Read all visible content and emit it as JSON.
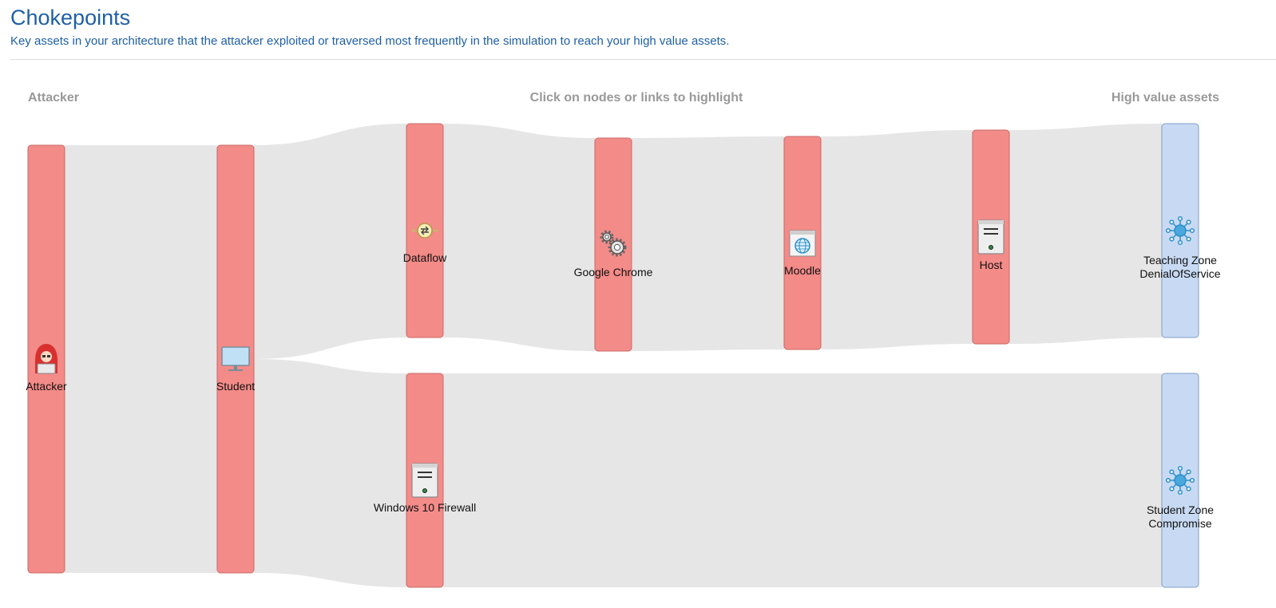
{
  "header": {
    "title": "Chokepoints",
    "subtitle": "Key assets in your architecture that the attacker exploited or traversed most frequently in the simulation to reach your high value assets."
  },
  "sankey": {
    "column_labels": {
      "left": "Attacker",
      "center": "Click on nodes or links to highlight",
      "right": "High value assets"
    },
    "colors": {
      "node_fill": "#f38b88",
      "node_stroke": "#c96a67",
      "target_fill": "#c8daf3",
      "target_stroke": "#7f9cc9",
      "link": "#e6e6e6"
    },
    "nodes": [
      {
        "id": "attacker",
        "label": [
          "Attacker"
        ],
        "icon": "hacker-icon",
        "kind": "source"
      },
      {
        "id": "student",
        "label": [
          "Student"
        ],
        "icon": "monitor-icon",
        "kind": "asset"
      },
      {
        "id": "dataflow",
        "label": [
          "Dataflow"
        ],
        "icon": "dataflow-icon",
        "kind": "asset"
      },
      {
        "id": "chrome",
        "label": [
          "Google Chrome"
        ],
        "icon": "gears-icon",
        "kind": "asset"
      },
      {
        "id": "moodle",
        "label": [
          "Moodle"
        ],
        "icon": "web-app-icon",
        "kind": "asset"
      },
      {
        "id": "host",
        "label": [
          "Host"
        ],
        "icon": "server-icon",
        "kind": "asset"
      },
      {
        "id": "teaching_zone",
        "label": [
          "Teaching Zone",
          "DenialOfService"
        ],
        "icon": "network-icon",
        "kind": "target"
      },
      {
        "id": "firewall",
        "label": [
          "Windows 10 Firewall"
        ],
        "icon": "server-icon",
        "kind": "asset"
      },
      {
        "id": "student_zone",
        "label": [
          "Student Zone",
          "Compromise"
        ],
        "icon": "network-icon",
        "kind": "target"
      }
    ],
    "links": [
      {
        "source": "attacker",
        "target": "student"
      },
      {
        "source": "student",
        "target": "dataflow"
      },
      {
        "source": "student",
        "target": "firewall"
      },
      {
        "source": "dataflow",
        "target": "chrome"
      },
      {
        "source": "chrome",
        "target": "moodle"
      },
      {
        "source": "moodle",
        "target": "host"
      },
      {
        "source": "host",
        "target": "teaching_zone"
      },
      {
        "source": "firewall",
        "target": "student_zone"
      }
    ]
  }
}
